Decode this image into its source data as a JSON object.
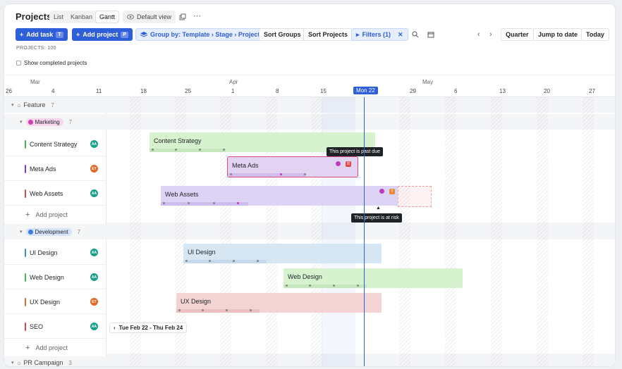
{
  "header": {
    "title": "Projects",
    "views": [
      "List",
      "Kanban",
      "Gantt"
    ],
    "active_view": "Gantt",
    "default_view": "Default view"
  },
  "toolbar": {
    "add_task": "Add task",
    "add_task_key": "T",
    "add_project": "Add project",
    "add_project_key": "P",
    "group_by": "Group by: Template › Stage › Project",
    "sort_groups": "Sort Groups",
    "sort_projects": "Sort Projects",
    "filters": "Filters (1)",
    "quarter": "Quarter",
    "jump_to_date": "Jump to date",
    "today": "Today"
  },
  "meta": {
    "projects_count": "PROJECTS: 100",
    "show_completed": "Show completed projects"
  },
  "timeline": {
    "months": [
      "Mar",
      "Apr",
      "May"
    ],
    "days": [
      "26",
      "4",
      "11",
      "18",
      "25",
      "1",
      "8",
      "15",
      "29",
      "6",
      "13",
      "20",
      "27"
    ],
    "today_label": "Mon 22"
  },
  "groups": {
    "feature": {
      "label": "Feature",
      "count": "7"
    },
    "marketing": {
      "label": "Marketing",
      "count": "7"
    },
    "development": {
      "label": "Development",
      "count": "7"
    },
    "pr": {
      "label": "PR Campaign",
      "count": "3"
    }
  },
  "projects": [
    {
      "name": "Content Strategy",
      "avatar": "AA",
      "color": "#3fbf4a",
      "avatar_color": "#1a9f8a"
    },
    {
      "name": "Meta Ads",
      "avatar": "ET",
      "color": "#7b3fd6",
      "avatar_color": "#e06a2a"
    },
    {
      "name": "Web Assets",
      "avatar": "AA",
      "color": "#d94a4a",
      "avatar_color": "#1a9f8a"
    },
    {
      "name": "UI Design",
      "avatar": "AA",
      "color": "#3a8fd8",
      "avatar_color": "#1a9f8a"
    },
    {
      "name": "Web Design",
      "avatar": "AA",
      "color": "#3fbf4a",
      "avatar_color": "#1a9f8a"
    },
    {
      "name": "UX Design",
      "avatar": "ET",
      "color": "#e06a2a",
      "avatar_color": "#e06a2a"
    },
    {
      "name": "SEO",
      "avatar": "AA",
      "color": "#d94a4a",
      "avatar_color": "#1a9f8a"
    }
  ],
  "add_project_label": "Add project",
  "bars": {
    "content_strategy": "Content Strategy",
    "meta_ads": "Meta Ads",
    "web_assets": "Web Assets",
    "ui_design": "UI Design",
    "web_design": "Web Design",
    "ux_design": "UX Design"
  },
  "tooltips": {
    "past_due": "This project is past due",
    "at_risk": "This project is at risk"
  },
  "badges": {
    "meta_ads": "!!",
    "web_assets": "!"
  },
  "date_range": "Tue Feb 22 - Thu Feb 24",
  "colors": {
    "primary": "#2f5ed9",
    "green_bar": "#d6f2cf",
    "purple_bar": "#e3d3f3",
    "lavender_bar": "#ddd3f5",
    "blue_bar": "#d6e6f3",
    "red_bar": "#f3d3d3",
    "marketing_chip": "#f7d6ee",
    "development_chip": "#d6e4fa"
  }
}
